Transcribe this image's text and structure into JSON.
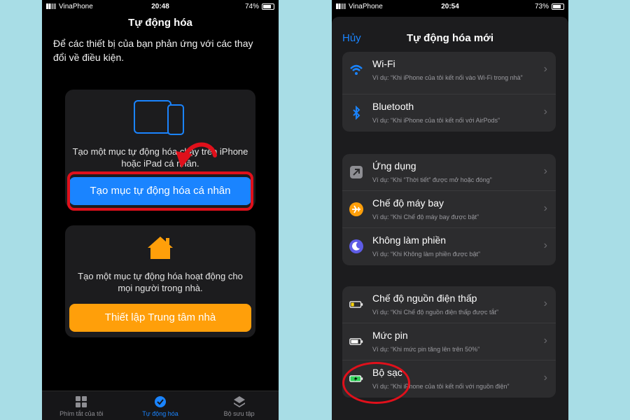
{
  "phone1": {
    "status": {
      "carrier": "VinaPhone",
      "time": "20:48",
      "battery": "74%"
    },
    "title": "Tự động hóa",
    "description": "Để các thiết bị của bạn phản ứng với các thay đổi về điều kiện.",
    "personal_card": {
      "text": "Tạo một mục tự động hóa chạy trên iPhone hoặc iPad cá nhân.",
      "button": "Tạo mục tự động hóa cá nhân"
    },
    "home_card": {
      "text": "Tạo một mục tự động hóa hoạt động cho mọi người trong nhà.",
      "button": "Thiết lập Trung tâm nhà"
    },
    "tabs": [
      "Phím tắt của tôi",
      "Tự động hóa",
      "Bộ sưu tập"
    ]
  },
  "phone2": {
    "status": {
      "carrier": "VinaPhone",
      "time": "20:54",
      "battery": "73%"
    },
    "nav": {
      "cancel": "Hủy",
      "title": "Tự động hóa mới"
    },
    "group1": [
      {
        "label": "Wi-Fi",
        "sub": "Ví dụ: “Khi iPhone của tôi kết nối vào Wi-Fi trong nhà”",
        "icon": "wifi-icon"
      },
      {
        "label": "Bluetooth",
        "sub": "Ví dụ: “Khi iPhone của tôi kết nối với AirPods”",
        "icon": "bluetooth-icon"
      }
    ],
    "group2": [
      {
        "label": "Ứng dụng",
        "sub": "Ví dụ: “Khi “Thời tiết” được mở hoặc đóng”",
        "icon": "app-icon"
      },
      {
        "label": "Chế độ máy bay",
        "sub": "Ví dụ: “Khi Chế độ máy bay được bật”",
        "icon": "airplane-icon"
      },
      {
        "label": "Không làm phiền",
        "sub": "Ví dụ: “Khi Không làm phiền được bật”",
        "icon": "moon-icon"
      }
    ],
    "group3": [
      {
        "label": "Chế độ nguồn điện thấp",
        "sub": "Ví dụ: “Khi Chế độ nguồn điện thấp được tắt”",
        "icon": "low-power-icon"
      },
      {
        "label": "Mức pin",
        "sub": "Ví dụ: “Khi mức pin tăng lên trên 50%”",
        "icon": "battery-icon"
      },
      {
        "label": "Bộ sạc",
        "sub": "Ví dụ: “Khi iPhone của tôi kết nối với nguồn điện”",
        "icon": "charger-icon"
      }
    ]
  },
  "colors": {
    "accent": "#1a84ff",
    "orange": "#ff9f0a",
    "highlight": "#e0101b",
    "background": "#a8dde6"
  }
}
